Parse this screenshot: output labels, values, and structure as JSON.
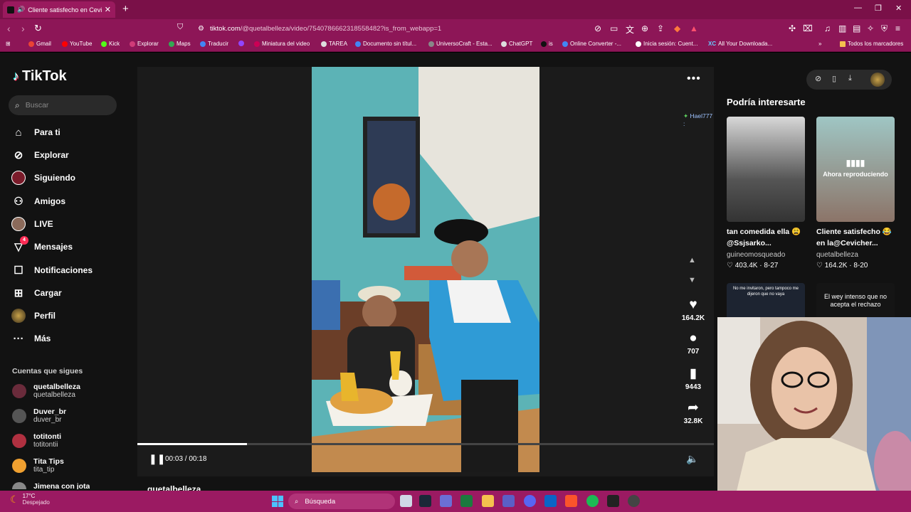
{
  "browser": {
    "tab_title": "Cliente satisfecho en Cevich",
    "url_main": "tiktok.com",
    "url_rest": "/@quetalbelleza/video/7540786662318558482?is_from_webapp=1",
    "bookmarks": [
      "Gmail",
      "YouTube",
      "Kick",
      "Explorar",
      "Maps",
      "Traducir",
      "",
      "Miniatura del video",
      "TAREA",
      "Documento sin títul...",
      "UniversoCraft - Esta...",
      "ChatGPT",
      "is",
      "Online Converter -...",
      "Inicia sesión: Cuent...",
      "All Your Downloada..."
    ],
    "bookmarks_folder": "Todos los marcadores"
  },
  "sidebar": {
    "logo": "TikTok",
    "search_placeholder": "Buscar",
    "items": [
      {
        "label": "Para ti",
        "icon": "home-icon"
      },
      {
        "label": "Explorar",
        "icon": "compass-icon"
      },
      {
        "label": "Siguiendo",
        "icon": "avatar"
      },
      {
        "label": "Amigos",
        "icon": "friends-icon"
      },
      {
        "label": "LIVE",
        "icon": "avatar"
      },
      {
        "label": "Mensajes",
        "icon": "messages-icon",
        "badge": "4"
      },
      {
        "label": "Notificaciones",
        "icon": "inbox-icon"
      },
      {
        "label": "Cargar",
        "icon": "upload-icon"
      },
      {
        "label": "Perfil",
        "icon": "avatar"
      },
      {
        "label": "Más",
        "icon": "more-icon"
      }
    ],
    "following_title": "Cuentas que sigues",
    "following": [
      {
        "name": "quetalbelleza",
        "handle": "quetalbelleza"
      },
      {
        "name": "Duver_br",
        "handle": "duver_br"
      },
      {
        "name": "totitonti",
        "handle": "totitontii"
      },
      {
        "name": "Tita Tips",
        "handle": "tita_tip"
      },
      {
        "name": "Jimena con jota",
        "handle": ""
      }
    ]
  },
  "video": {
    "time": "00:03 / 00:18",
    "progress": 0.19,
    "comment_user": "Hael777 :",
    "likes": "164.2K",
    "comments": "707",
    "saves": "9443",
    "shares": "32.8K",
    "author": "quetalbelleza"
  },
  "recommendations": {
    "title": "Podría interesarte",
    "cards": [
      {
        "title": "tan comedida ella 😩 @Ssjsarko...",
        "user": "guineomosqueado",
        "likes": "403.4K",
        "date": "8-27"
      },
      {
        "title": "Cliente satisfecho 😂 en la@Cevicher...",
        "user": "quetalbelleza",
        "likes": "164.2K",
        "date": "8-20",
        "now_playing": "Ahora reproduciendo"
      }
    ],
    "thumb3_text": "No me invitaron, pero tampoco me dijeron que no vaya",
    "thumb4_text": "El wey intenso que no acepta el rechazo"
  },
  "taskbar": {
    "temp": "17°C",
    "weather": "Despejado",
    "search": "Búsqueda"
  }
}
